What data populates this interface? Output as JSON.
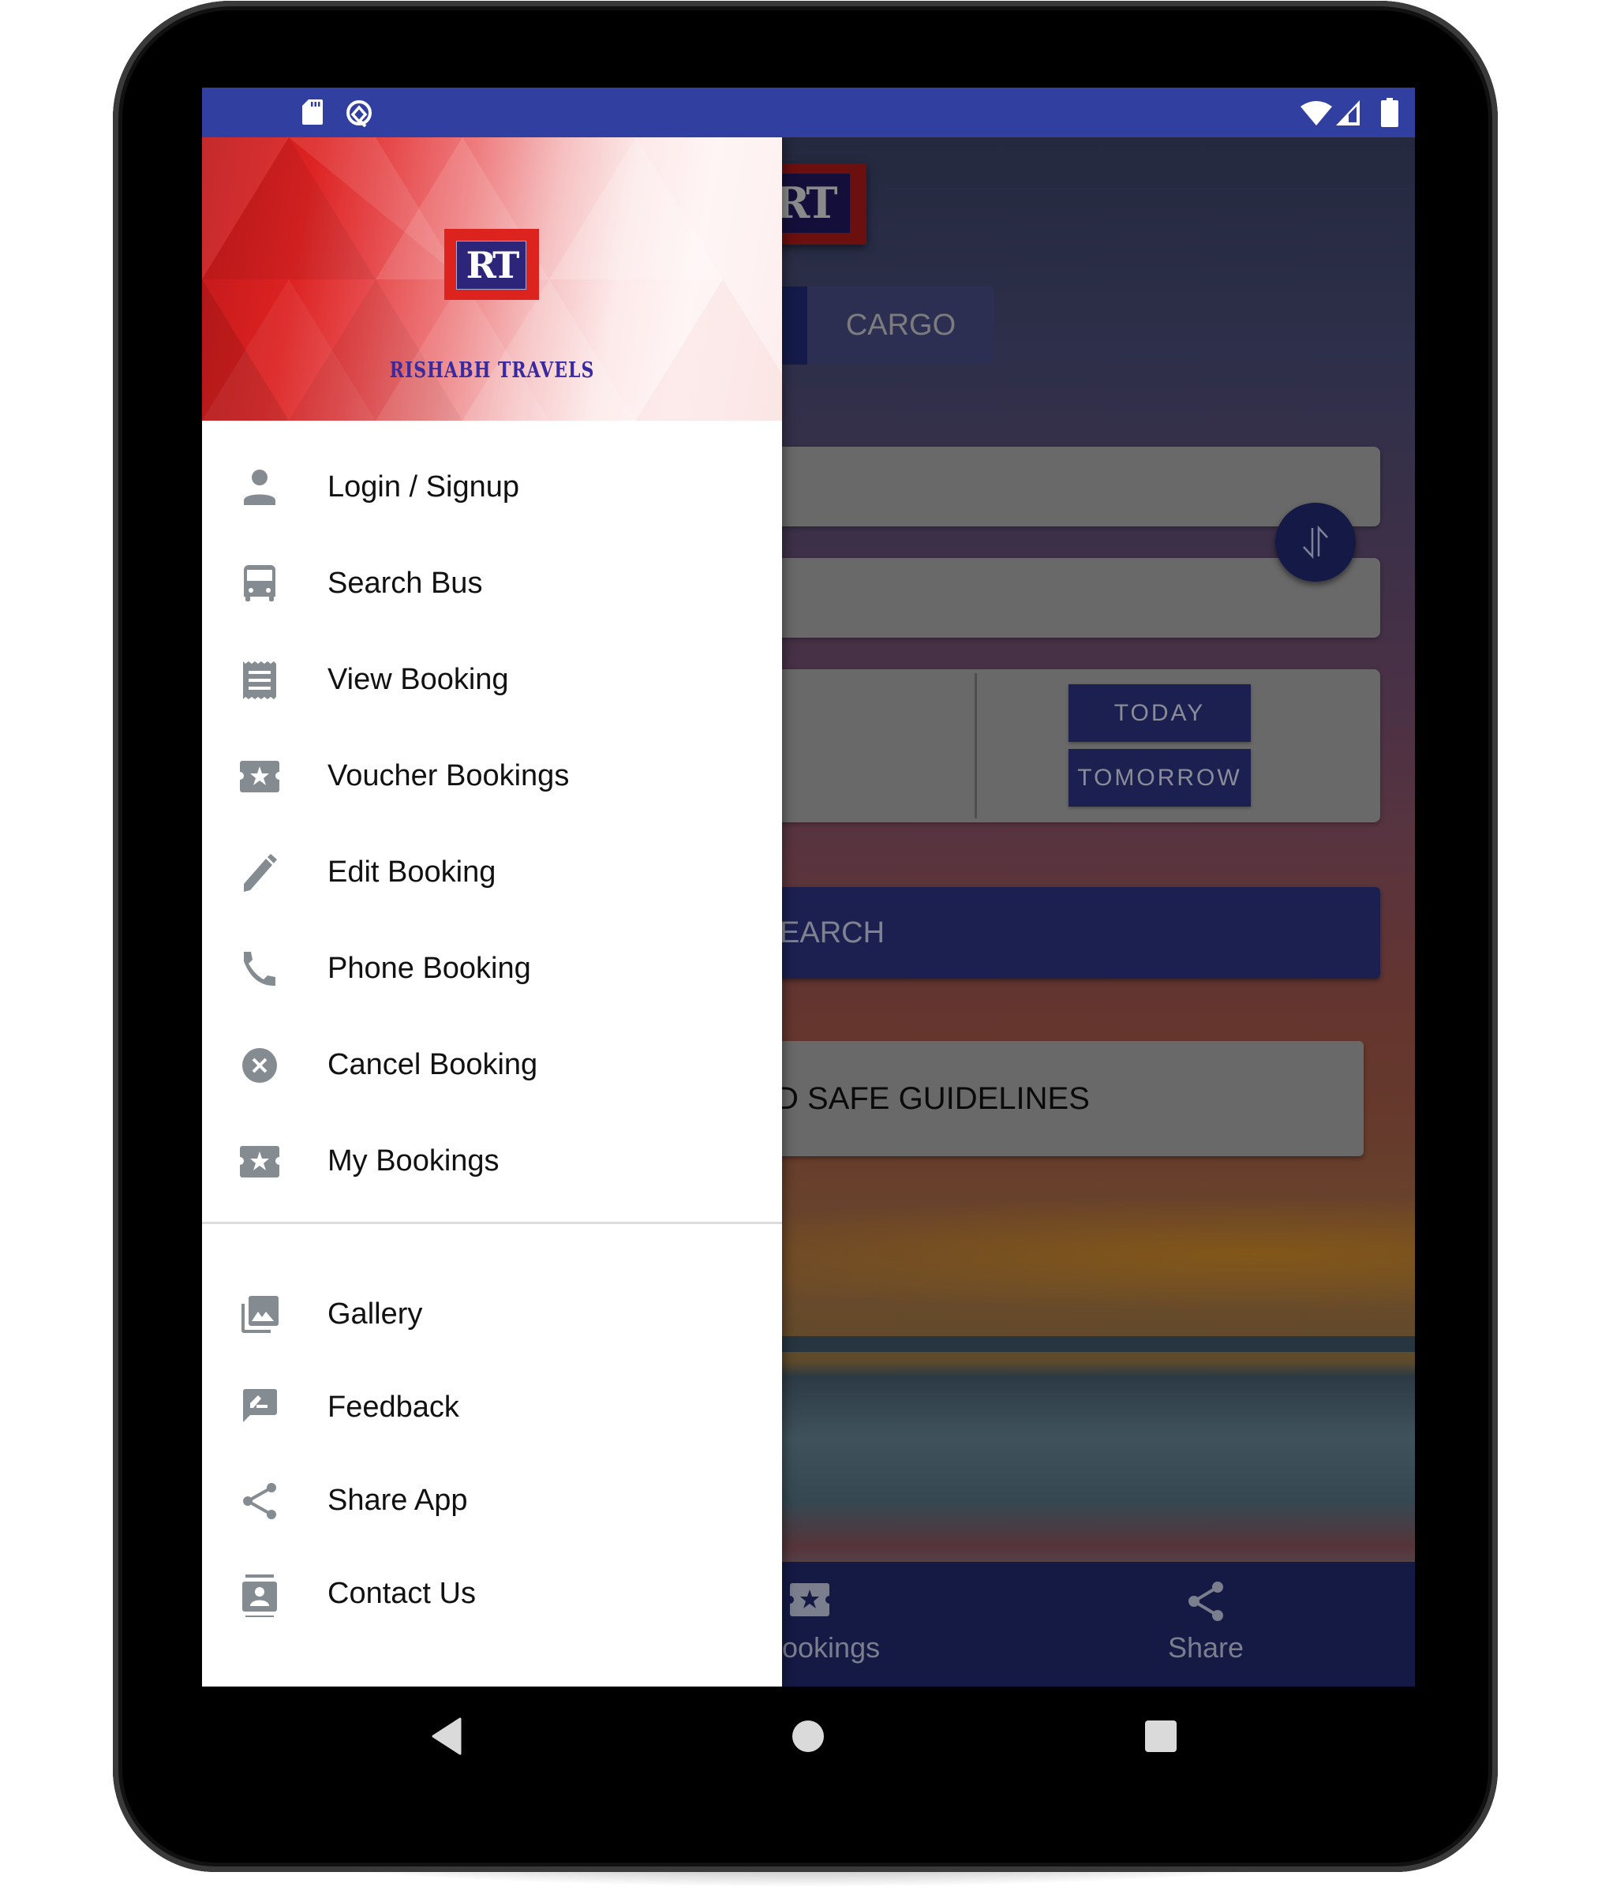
{
  "status_bar": {
    "left_icons": [
      "sd-card-icon",
      "q-notification-icon"
    ],
    "right_icons": [
      "wifi-icon",
      "cell-signal-icon",
      "battery-icon"
    ],
    "color": "#3140a0"
  },
  "drawer": {
    "brand_logo_text": "RT",
    "brand_name": "RISHABH TRAVELS",
    "primary_items": [
      {
        "label": "Login / Signup",
        "icon": "person-icon"
      },
      {
        "label": "Search Bus",
        "icon": "bus-icon"
      },
      {
        "label": "View Booking",
        "icon": "receipt-icon"
      },
      {
        "label": "Voucher Bookings",
        "icon": "ticket-star-icon"
      },
      {
        "label": "Edit Booking",
        "icon": "pencil-icon"
      },
      {
        "label": "Phone Booking",
        "icon": "phone-icon"
      },
      {
        "label": "Cancel Booking",
        "icon": "cancel-circle-icon"
      },
      {
        "label": "My Bookings",
        "icon": "ticket-star-icon"
      }
    ],
    "secondary_items": [
      {
        "label": "Gallery",
        "icon": "gallery-icon"
      },
      {
        "label": "Feedback",
        "icon": "feedback-icon"
      },
      {
        "label": "Share App",
        "icon": "share-icon"
      },
      {
        "label": "Contact Us",
        "icon": "contact-icon"
      }
    ],
    "icon_color": "#848c92"
  },
  "main": {
    "logo_text": "RT",
    "tabs": [
      {
        "label": "",
        "active": true
      },
      {
        "label": "CARGO",
        "active": false
      }
    ],
    "from_field": {
      "value": ""
    },
    "to_field": {
      "value": ""
    },
    "swap_icon": "swap-vertical-icon",
    "date_buttons": {
      "today": "TODAY",
      "tomorrow": "TOMORROW"
    },
    "search_button_visible_text": "EARCH",
    "guidelines_visible_text": "D SAFE GUIDELINES",
    "bottom_nav": [
      {
        "label": "ookings",
        "icon": "ticket-star-icon"
      },
      {
        "label": "Share",
        "icon": "share-icon"
      }
    ],
    "accent_color": "#1b2050"
  },
  "system_nav": {
    "buttons": [
      "back-icon",
      "home-icon",
      "recents-icon"
    ]
  }
}
